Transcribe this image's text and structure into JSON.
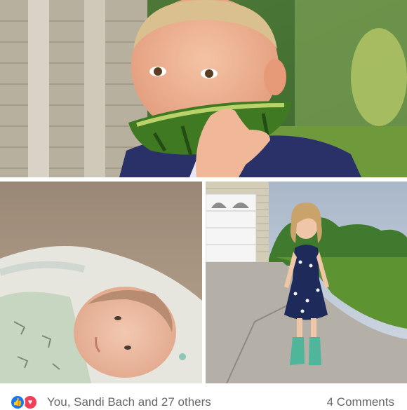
{
  "post": {
    "photos": [
      {
        "name": "boy-eating-watermelon"
      },
      {
        "name": "sleeping-newborn"
      },
      {
        "name": "girl-in-rain-boots"
      }
    ],
    "reactions": {
      "icons": [
        "like-icon",
        "love-icon"
      ],
      "text": "You, Sandi Bach and 27 others"
    },
    "comments": "4 Comments"
  },
  "colors": {
    "like": "#1877f2",
    "love": "#f33e58",
    "meta_text": "#65676b"
  }
}
